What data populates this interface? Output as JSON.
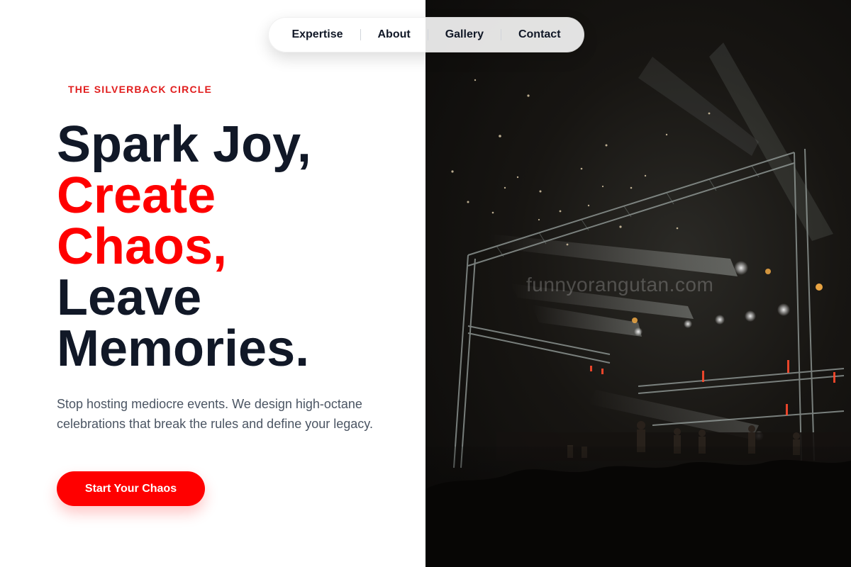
{
  "nav": {
    "items": [
      {
        "label": "Expertise"
      },
      {
        "label": "About"
      },
      {
        "label": "Gallery"
      },
      {
        "label": "Contact"
      }
    ]
  },
  "hero": {
    "eyebrow": "THE SILVERBACK CIRCLE",
    "headline_lines": [
      "Spark Joy,",
      "Create",
      "Chaos,",
      "Leave",
      "Memories."
    ],
    "subtitle": "Stop hosting mediocre events. We design high-octane celebrations that break the rules and define your legacy.",
    "cta_label": "Start Your Chaos"
  },
  "photo": {
    "watermark": "funnyorangutan.com"
  },
  "colors": {
    "accent": "#ff0000",
    "eyebrow": "#e11d1d",
    "text_dark": "#111827",
    "text_muted": "#4b5563"
  }
}
